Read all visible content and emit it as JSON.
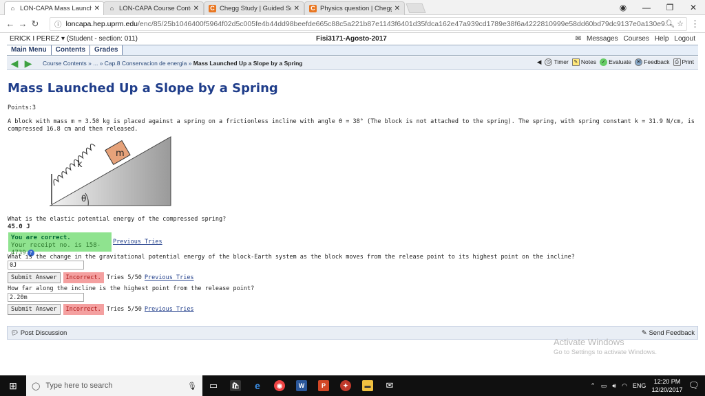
{
  "browser": {
    "tabs": [
      {
        "title": "LON-CAPA Mass Launche",
        "favicon": "loncapa",
        "active": true
      },
      {
        "title": "LON-CAPA Course Conte",
        "favicon": "loncapa",
        "active": false
      },
      {
        "title": "Chegg Study | Guided So",
        "favicon": "chegg",
        "active": false
      },
      {
        "title": "Physics question | Chegg",
        "favicon": "chegg",
        "active": false
      }
    ],
    "url_host": "loncapa.hep.uprm.edu",
    "url_path": "/enc/85/25b1046400f5964f02d5c005fe4b44dd98beefde665c88c5a221b87e1143f6401d35fdca162e47a939cd1789e38f6a4222810999e58dd60bd79dc9137e0a130e9..."
  },
  "header": {
    "user": "ERICK I PEREZ ▾ (Student  - section: 011)",
    "course": "Fisi3171-Agosto-2017",
    "links": [
      "Messages",
      "Courses",
      "Help",
      "Logout"
    ]
  },
  "menu": [
    "Main Menu",
    "Contents",
    "Grades"
  ],
  "nav": {
    "crumb_1": "Course Contents »",
    "crumb_2": "... » Cap.8 Conservacion de energia »",
    "crumb_current": "Mass Launched Up a Slope by a Spring",
    "tools": [
      "Timer",
      "Notes",
      "Evaluate",
      "Feedback",
      "Print"
    ]
  },
  "problem": {
    "title": "Mass Launched Up a Slope by a Spring",
    "points": "Points:3",
    "text": "A block with mass m = 3.50 kg is placed against a spring on a frictionless incline with angle θ = 38° (The block is not attached to the spring). The spring, with spring constant k = 31.9 N/cm, is compressed 16.8 cm and then released.",
    "figure_labels": {
      "mass": "m",
      "spring": "k",
      "angle": "θ"
    },
    "q1": "What is the elastic potential energy of the compressed spring?",
    "a1": "45.0 J",
    "correct_title": "You are correct.",
    "correct_receipt": "Your receipt no. is 158-4739",
    "prev_tries": "Previous Tries",
    "q2": "What is the change in the gravitational potential energy of the block-Earth system as the block moves from the release point to its highest point on the incline?",
    "a2": "0J",
    "q3": "How far along the incline is the highest point from the release point?",
    "a3": "2.20m",
    "submit_label": "Submit Answer",
    "incorrect_label": "Incorrect.",
    "tries": "Tries 5/50"
  },
  "footer": {
    "post_discussion": "Post Discussion",
    "send_feedback": "Send Feedback"
  },
  "watermark": {
    "line1": "Activate Windows",
    "line2": "Go to Settings to activate Windows."
  },
  "taskbar": {
    "search_placeholder": "Type here to search",
    "lang": "ENG",
    "time": "12:20 PM",
    "date": "12/20/2017"
  }
}
